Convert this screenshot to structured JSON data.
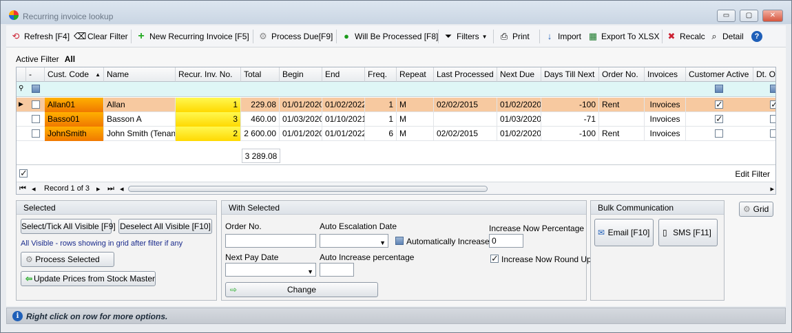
{
  "window": {
    "title": "Recurring invoice lookup",
    "min": "▭",
    "max": "▢",
    "close": "✕"
  },
  "toolbar": {
    "refresh": "Refresh [F4]",
    "clear_filter": "Clear Filter",
    "new_recurring": "New Recurring Invoice [F5]",
    "process_due": "Process Due[F9]",
    "will_be_processed": "Will Be Processed [F8]",
    "filters": "Filters",
    "print": "Print",
    "import": "Import",
    "export": "Export To XLSX",
    "recalc": "Recalc",
    "detail": "Detail",
    "help": "?"
  },
  "active_filter": {
    "label": "Active Filter",
    "value": "All"
  },
  "grid": {
    "columns": [
      "-",
      "Cust. Code",
      "Name",
      "Recur. Inv. No.",
      "Total",
      "Begin",
      "End",
      "Freq.",
      "Repeat",
      "Last Processed",
      "Next Due",
      "Days Till Next",
      "Order No.",
      "Invoices",
      "Customer Active",
      "Dt. Or"
    ],
    "rows": [
      {
        "code": "Allan01",
        "name": "Allan",
        "recur_no": "1",
        "total": "229.08",
        "begin": "01/01/2020",
        "end": "01/02/2022",
        "freq": "1",
        "repeat": "M",
        "last_processed": "02/02/2015",
        "next_due": "01/02/2020",
        "days": "-100",
        "order_no": "Rent",
        "invoices": "Invoices",
        "customer_active": true
      },
      {
        "code": "Basso01",
        "name": "Basson A",
        "recur_no": "3",
        "total": "460.00",
        "begin": "01/03/2020",
        "end": "01/10/2021",
        "freq": "1",
        "repeat": "M",
        "last_processed": "",
        "next_due": "01/03/2020",
        "days": "-71",
        "order_no": "",
        "invoices": "Invoices",
        "customer_active": true
      },
      {
        "code": "JohnSmith",
        "name": "John Smith (Tenant)",
        "recur_no": "2",
        "total": "2 600.00",
        "begin": "01/01/2020",
        "end": "01/01/2022",
        "freq": "6",
        "repeat": "M",
        "last_processed": "02/02/2015",
        "next_due": "01/02/2020",
        "days": "-100",
        "order_no": "Rent",
        "invoices": "Invoices",
        "customer_active": false
      }
    ],
    "total_sum": "3 289.08",
    "edit_filter": "Edit Filter",
    "record_text": "Record 1 of 3"
  },
  "selected_panel": {
    "title": "Selected",
    "select_all": "Select/Tick All Visible [F9]",
    "deselect_all": "Deselect All Visible [F10]",
    "note": "All Visible - rows showing in grid after filter if any",
    "process_selected": "Process Selected",
    "update_prices": "Update Prices from Stock Master"
  },
  "with_selected_panel": {
    "title": "With Selected",
    "order_no_label": "Order No.",
    "order_no_value": "",
    "auto_escalation_label": "Auto Escalation Date",
    "auto_escalation_value": "",
    "auto_increase_chk": "Automatically Increase",
    "increase_now_label": "Increase Now Percentage",
    "increase_now_value": "0",
    "next_pay_label": "Next Pay Date",
    "next_pay_value": "",
    "auto_increase_pct_label": "Auto Increase percentage",
    "auto_increase_pct_value": "",
    "round_up": "Increase Now Round Up",
    "change": "Change"
  },
  "bulk_panel": {
    "title": "Bulk Communication",
    "email": "Email [F10]",
    "sms": "SMS [F11]"
  },
  "grid_button": "Grid",
  "status": {
    "text": "Right click on row for more options."
  }
}
